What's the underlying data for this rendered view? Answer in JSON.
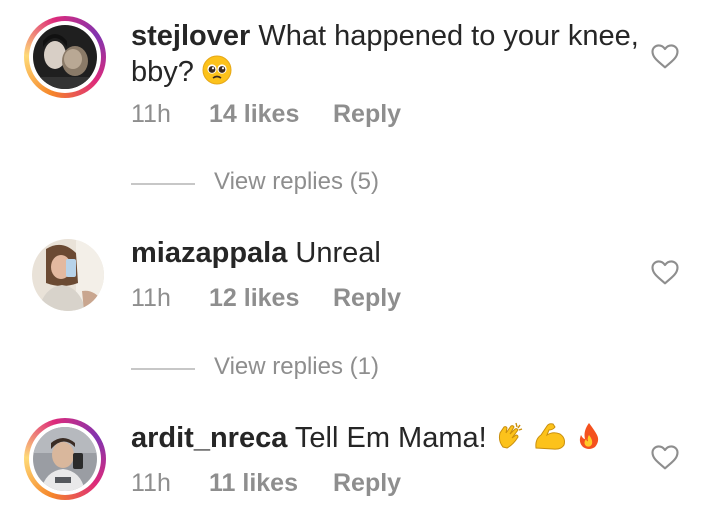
{
  "comments": [
    {
      "username": "stejlover",
      "text": "What happened to your knee,",
      "text_line2": "bby?",
      "emoji_icons": [
        "pleading-face-emoji"
      ],
      "time": "11h",
      "likes": "14 likes",
      "reply": "Reply",
      "view_replies": "View replies (5)",
      "has_story_ring": true
    },
    {
      "username": "miazappala",
      "text": "Unreal",
      "time": "11h",
      "likes": "12 likes",
      "reply": "Reply",
      "view_replies": "View replies (1)",
      "has_story_ring": false
    },
    {
      "username": "ardit_nreca",
      "text": "Tell Em Mama!",
      "emoji_icons": [
        "clapping-hands-emoji",
        "flexed-biceps-emoji",
        "fire-emoji"
      ],
      "time": "11h",
      "likes": "11 likes",
      "reply": "Reply",
      "has_story_ring": true
    }
  ],
  "colors": {
    "text": "#262626",
    "secondary": "#8e8e8e",
    "divider": "#c7c7c7",
    "ring_orange": "#f58529",
    "ring_pink": "#dd2a7b",
    "ring_purple": "#8134af"
  }
}
